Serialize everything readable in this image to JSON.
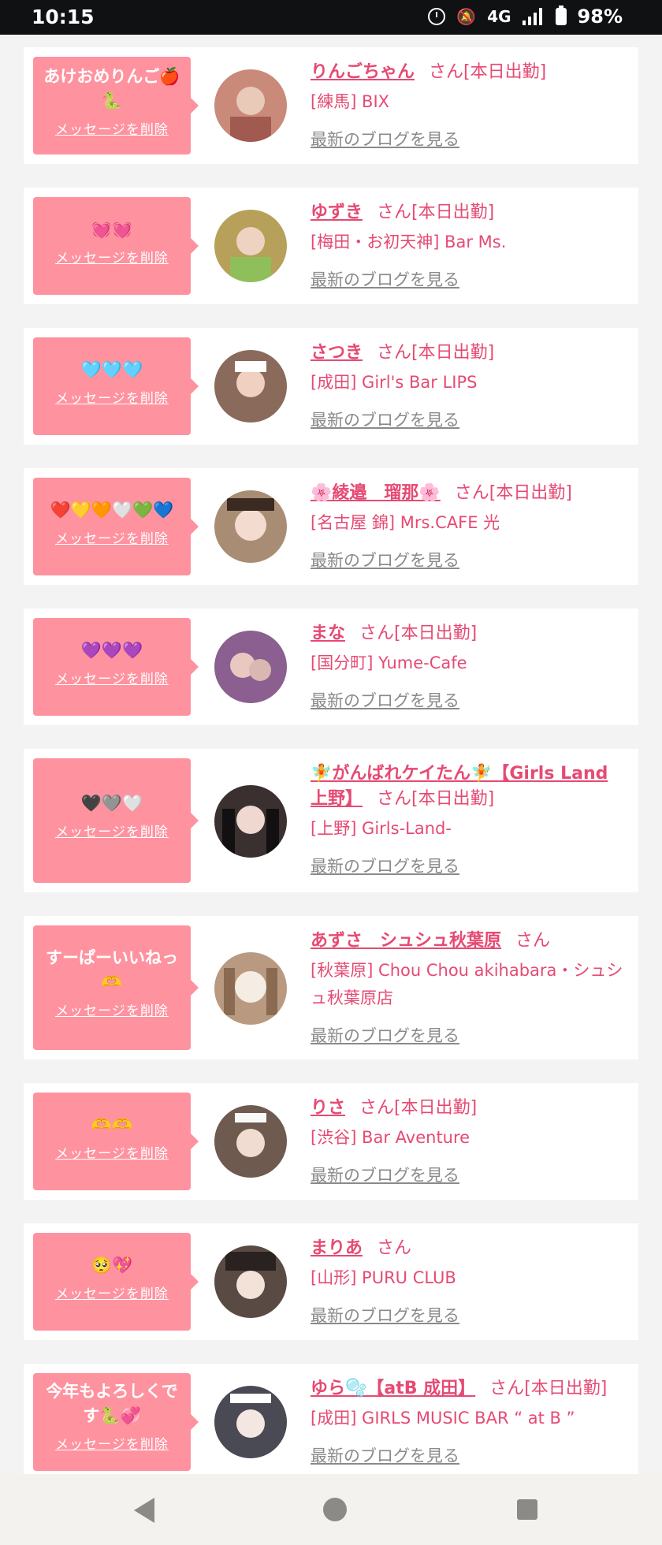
{
  "status_bar": {
    "time": "10:15",
    "network": "4G",
    "battery": "98%"
  },
  "actions": {
    "delete_label": "メッセージを削除",
    "blog_label": "最新のブログを見る"
  },
  "messages": [
    {
      "message": "あけおめりんご🍎🐍",
      "name": "りんごちゃん",
      "suffix": "さん[本日出勤]",
      "shop": "[練馬] BIX",
      "avatar_color": "#c98a7a"
    },
    {
      "message": "💓💓",
      "name": "ゆずき",
      "suffix": "さん[本日出勤]",
      "shop": "[梅田・お初天神] Bar Ms.",
      "avatar_color": "#b7a05a"
    },
    {
      "message": "🩵🩵🩵",
      "name": "さつき",
      "suffix": "さん[本日出勤]",
      "shop": "[成田] Girl's Bar LIPS",
      "avatar_color": "#8a6a5a"
    },
    {
      "message": "❤️💛🧡🤍💚💙",
      "name": "🌸綾邉　瑠那🌸",
      "suffix": "さん[本日出勤]",
      "shop": "[名古屋 錦] Mrs.CAFE 光",
      "avatar_color": "#a88d74"
    },
    {
      "message": "💜💜💜",
      "name": "まな",
      "suffix": "さん[本日出勤]",
      "shop": "[国分町] Yume-Cafe",
      "avatar_color": "#8b5f8f"
    },
    {
      "message": "🖤🩶🤍",
      "name": "🧚がんばれケイたん🧚【Girls Land 上野】",
      "suffix": "さん[本日出勤]",
      "shop": "[上野] Girls-Land-",
      "avatar_color": "#3a3030"
    },
    {
      "message": "すーぱーいいねっ🫶",
      "name": "あずさ　シュシュ秋葉原",
      "suffix": "さん",
      "shop": "[秋葉原] Chou Chou akihabara・シュシュ秋葉原店",
      "avatar_color": "#b99a80"
    },
    {
      "message": "🫶🫶",
      "name": "りさ",
      "suffix": "さん[本日出勤]",
      "shop": "[渋谷] Bar Aventure",
      "avatar_color": "#6e5a4e"
    },
    {
      "message": "🥺💖",
      "name": "まりあ",
      "suffix": "さん",
      "shop": "[山形] PURU CLUB",
      "avatar_color": "#5a4a44"
    },
    {
      "message": "今年もよろしくです🐍💞",
      "name": "ゆら🫧【atB 成田】",
      "suffix": "さん[本日出勤]",
      "shop": "[成田] GIRLS MUSIC BAR “ at B ”",
      "avatar_color": "#4a4a55"
    }
  ]
}
